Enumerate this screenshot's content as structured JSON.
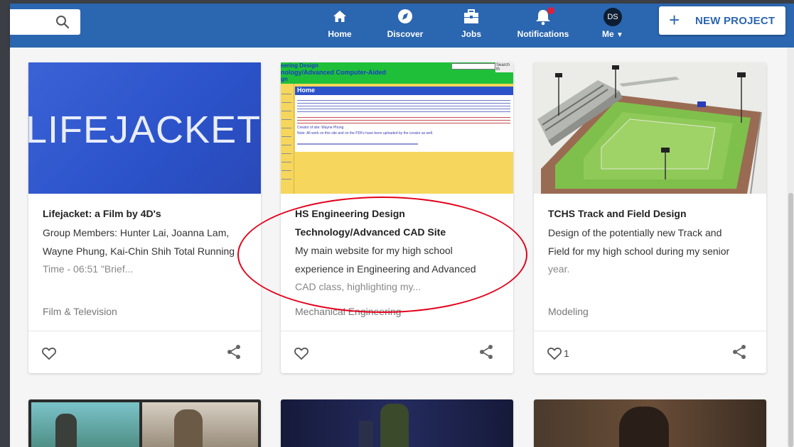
{
  "navbar": {
    "search_icon": "search-icon",
    "items": [
      {
        "label": "Home",
        "icon": "home-icon"
      },
      {
        "label": "Discover",
        "icon": "compass-icon"
      },
      {
        "label": "Jobs",
        "icon": "briefcase-icon"
      },
      {
        "label": "Notifications",
        "icon": "bell-icon"
      },
      {
        "label": "Me",
        "icon": "avatar"
      }
    ],
    "avatar_initials": "DS",
    "new_project_label": "NEW PROJECT",
    "colors": {
      "bar": "#2b66b0",
      "notification_dot": "#e0203a"
    }
  },
  "projects": [
    {
      "thumbnail_text": "LIFEJACKET",
      "title": "Lifejacket: a Film by 4D's",
      "description_lines": [
        "Group Members: Hunter Lai, Joanna Lam,",
        "Wayne Phung, Kai-Chin Shih Total Running"
      ],
      "description_fade": "Time - 06:51 \"Brief...",
      "category": "Film & Television",
      "likes": ""
    },
    {
      "thumbnail": {
        "header_line1": "eering Design",
        "header_line2": "nology/Advanced Computer-Aided",
        "header_line3": "gn",
        "search_button": "Search th",
        "home_heading": "Home",
        "creator_line1": "Creator of site: Wayne Phung",
        "creator_line2": "Note: All work on this site and on the PDFs have been uploaded by the creator as well."
      },
      "title_lines": [
        "HS Engineering Design",
        "Technology/Advanced CAD Site"
      ],
      "description_lines": [
        "My main website for my high school",
        "experience in Engineering and Advanced"
      ],
      "description_fade": "CAD class, highlighting my...",
      "category": "Mechanical Engineering",
      "likes": ""
    },
    {
      "title": "TCHS Track and Field Design",
      "description_lines": [
        "Design of the potentially new Track and",
        "Field for my high school during my senior"
      ],
      "description_fade": "year.",
      "category": "Modeling",
      "likes": "1"
    }
  ]
}
